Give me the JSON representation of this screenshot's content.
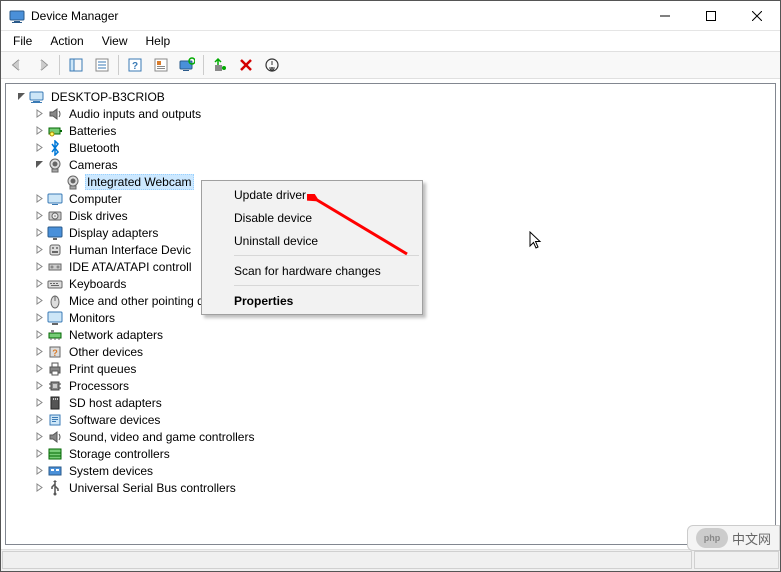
{
  "window": {
    "title": "Device Manager"
  },
  "menu": {
    "file": "File",
    "action": "Action",
    "view": "View",
    "help": "Help"
  },
  "tree": {
    "root": "DESKTOP-B3CRIOB",
    "items": [
      {
        "label": "Audio inputs and outputs",
        "icon": "speaker"
      },
      {
        "label": "Batteries",
        "icon": "battery"
      },
      {
        "label": "Bluetooth",
        "icon": "bluetooth"
      },
      {
        "label": "Cameras",
        "icon": "camera",
        "expanded": true,
        "children": [
          {
            "label": "Integrated Webcam",
            "icon": "camera",
            "selected": true
          }
        ]
      },
      {
        "label": "Computer",
        "icon": "computer"
      },
      {
        "label": "Disk drives",
        "icon": "disk"
      },
      {
        "label": "Display adapters",
        "icon": "display"
      },
      {
        "label": "Human Interface Devic",
        "icon": "hid"
      },
      {
        "label": "IDE ATA/ATAPI controll",
        "icon": "ide"
      },
      {
        "label": "Keyboards",
        "icon": "keyboard"
      },
      {
        "label": "Mice and other pointing devices",
        "icon": "mouse"
      },
      {
        "label": "Monitors",
        "icon": "monitor"
      },
      {
        "label": "Network adapters",
        "icon": "network"
      },
      {
        "label": "Other devices",
        "icon": "other"
      },
      {
        "label": "Print queues",
        "icon": "printer"
      },
      {
        "label": "Processors",
        "icon": "cpu"
      },
      {
        "label": "SD host adapters",
        "icon": "sd"
      },
      {
        "label": "Software devices",
        "icon": "software"
      },
      {
        "label": "Sound, video and game controllers",
        "icon": "sound"
      },
      {
        "label": "Storage controllers",
        "icon": "storage"
      },
      {
        "label": "System devices",
        "icon": "system"
      },
      {
        "label": "Universal Serial Bus controllers",
        "icon": "usb"
      }
    ]
  },
  "ctx": {
    "update": "Update driver",
    "disable": "Disable device",
    "uninstall": "Uninstall device",
    "scan": "Scan for hardware changes",
    "props": "Properties"
  },
  "watermark": {
    "logo": "php",
    "text": "中文网"
  }
}
